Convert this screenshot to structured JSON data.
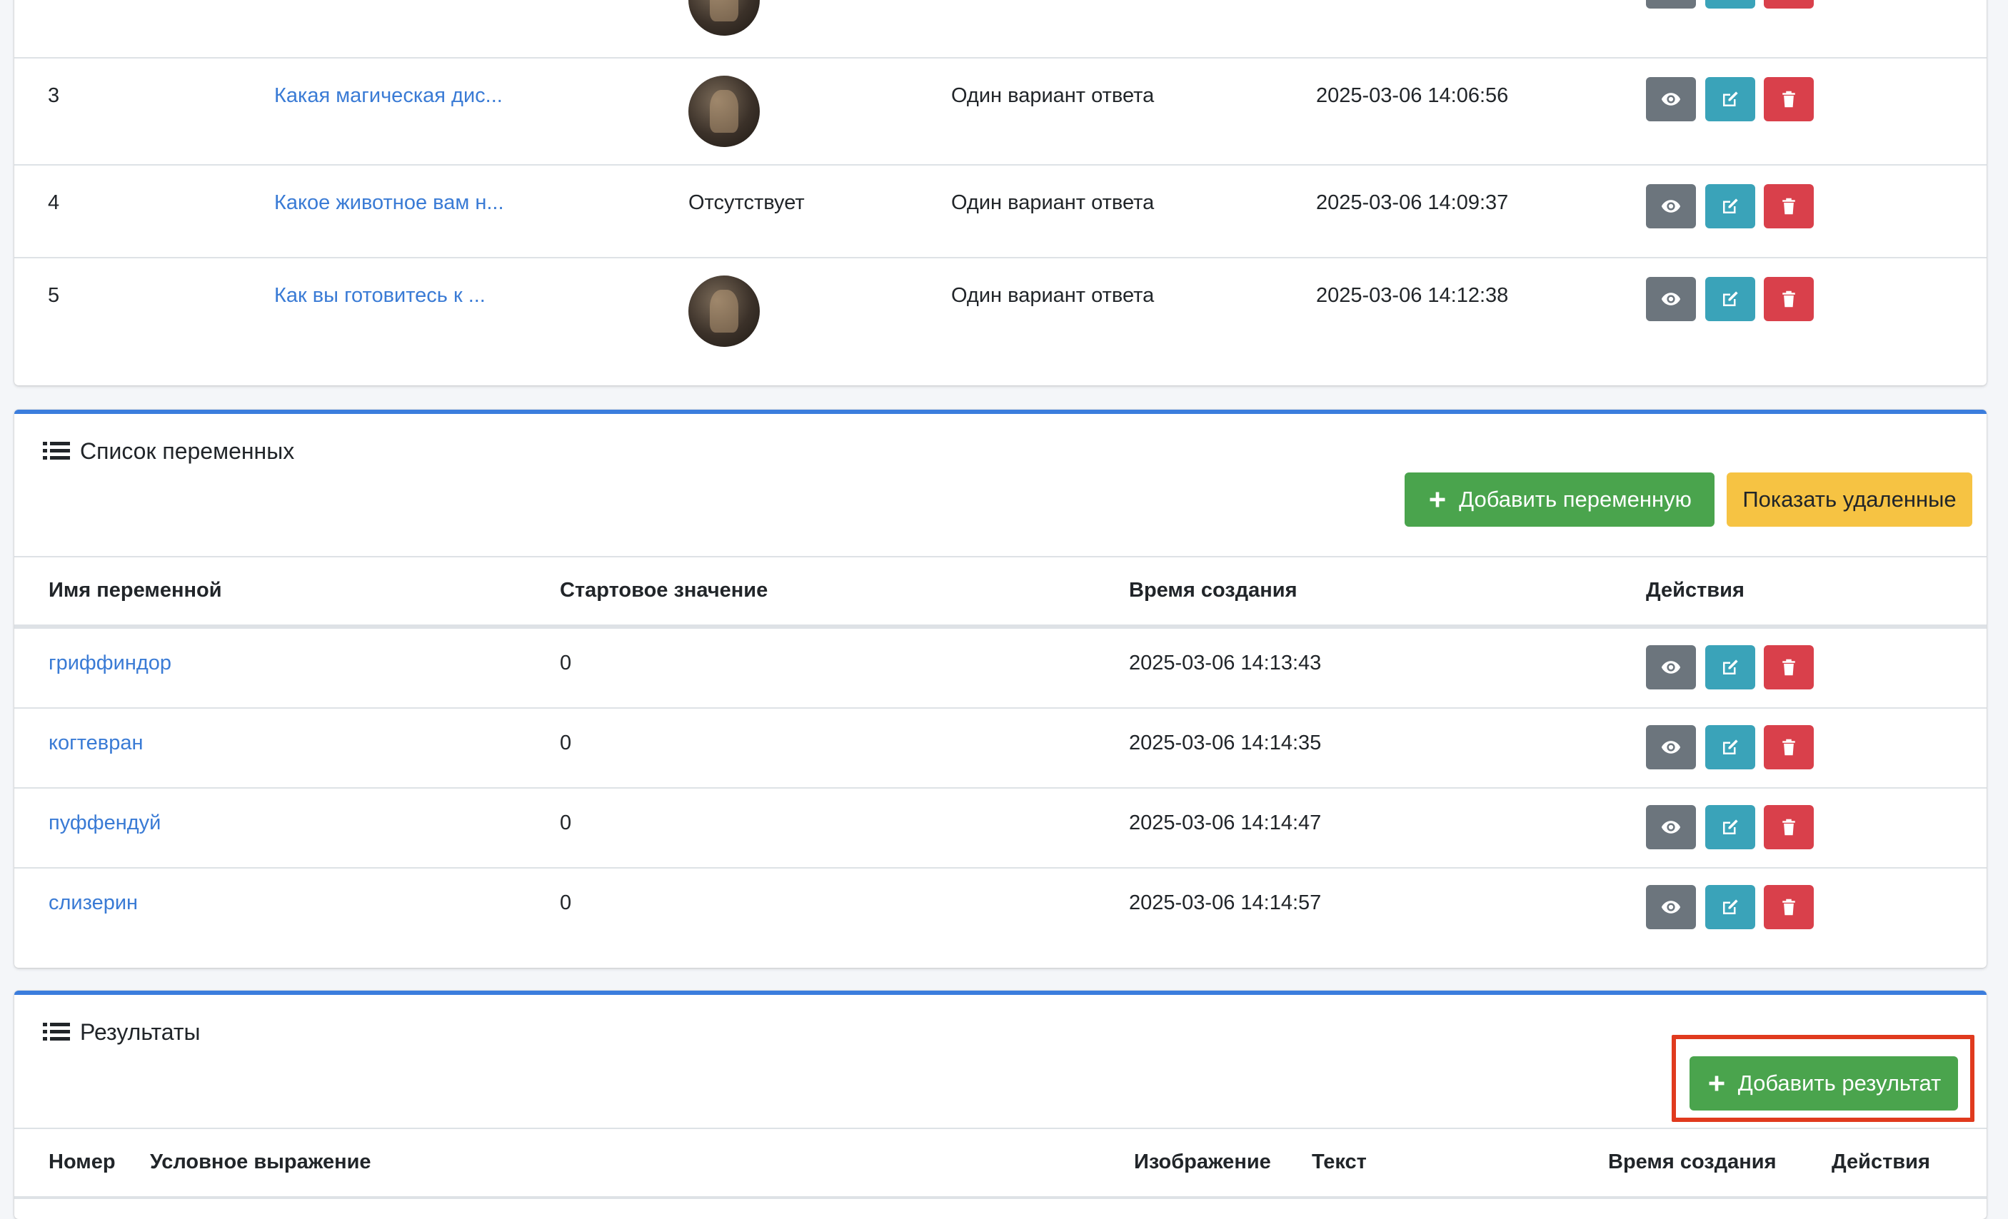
{
  "questions": {
    "rows": [
      {
        "num": "3",
        "title": "Какая магическая дис...",
        "image": "photo",
        "type": "Один вариант ответа",
        "created": "2025-03-06 14:06:56"
      },
      {
        "num": "4",
        "title": "Какое животное вам н...",
        "image_text": "Отсутствует",
        "type": "Один вариант ответа",
        "created": "2025-03-06 14:09:37"
      },
      {
        "num": "5",
        "title": "Как вы готовитесь к ...",
        "image": "photo",
        "type": "Один вариант ответа",
        "created": "2025-03-06 14:12:38"
      }
    ]
  },
  "variables": {
    "title": "Список переменных",
    "add_button": "Добавить переменную",
    "show_deleted_button": "Показать удаленные",
    "columns": [
      "Имя переменной",
      "Стартовое значение",
      "Время создания",
      "Действия"
    ],
    "rows": [
      {
        "name": "гриффиндор",
        "start": "0",
        "created": "2025-03-06 14:13:43"
      },
      {
        "name": "когтевран",
        "start": "0",
        "created": "2025-03-06 14:14:35"
      },
      {
        "name": "пуффендуй",
        "start": "0",
        "created": "2025-03-06 14:14:47"
      },
      {
        "name": "слизерин",
        "start": "0",
        "created": "2025-03-06 14:14:57"
      }
    ]
  },
  "results": {
    "title": "Результаты",
    "add_button": "Добавить результат",
    "columns": [
      "Номер",
      "Условное выражение",
      "Изображение",
      "Текст",
      "Время создания",
      "Действия"
    ]
  },
  "colors": {
    "accent": "#3b7ddd",
    "success": "#4aa44d",
    "warning": "#f6c343",
    "secondary": "#6c757d",
    "info": "#3aa3b9",
    "danger": "#d9404b",
    "highlight": "#e03a1e",
    "link": "#3a7bd5"
  },
  "icons": {
    "view": "eye-icon",
    "edit": "edit-icon",
    "delete": "trash-icon",
    "list": "list-icon",
    "add": "plus-icon"
  }
}
